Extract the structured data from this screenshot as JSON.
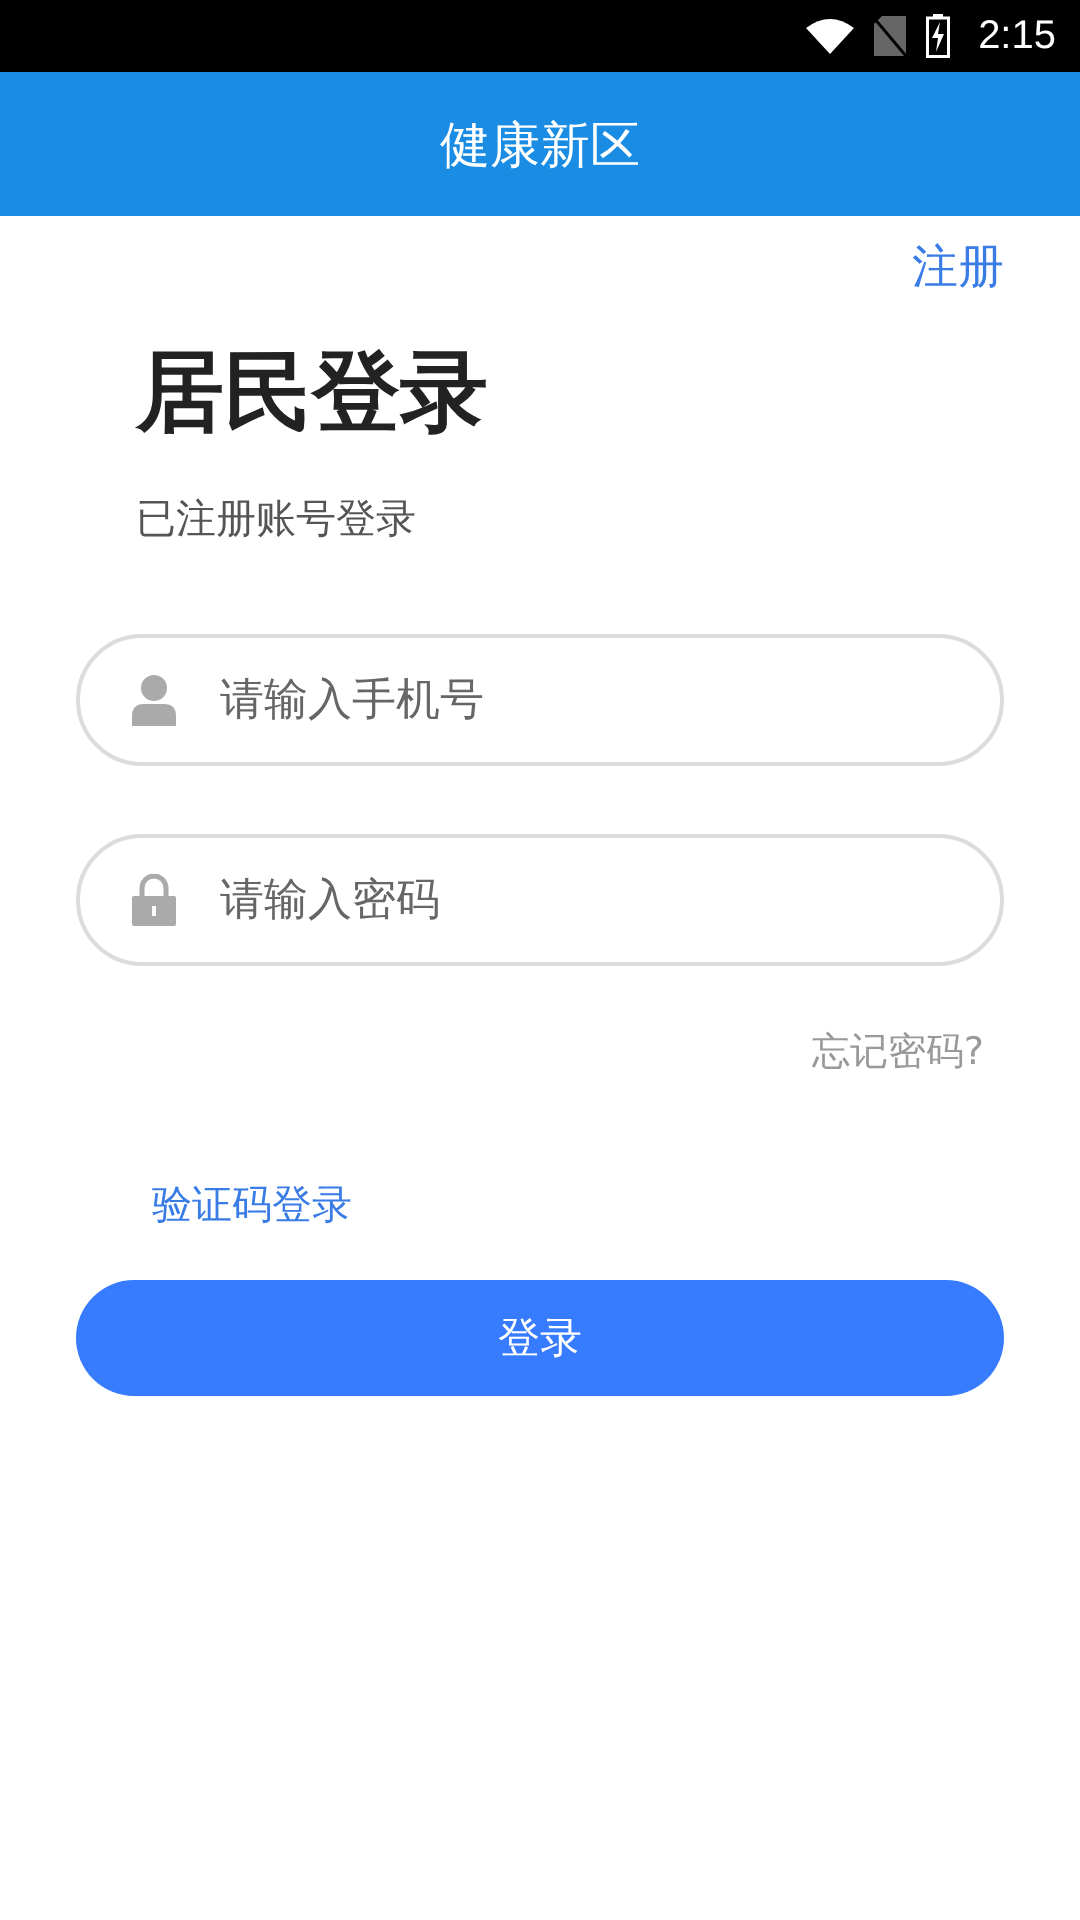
{
  "status_bar": {
    "time": "2:15"
  },
  "header": {
    "title": "健康新区"
  },
  "register_link": "注册",
  "heading": "居民登录",
  "subheading": "已注册账号登录",
  "fields": [
    {
      "kind": "user",
      "placeholder": "请输入手机号"
    },
    {
      "kind": "lock",
      "placeholder": "请输入密码"
    }
  ],
  "forgot_link": "忘记密码?",
  "sms_login_link": "验证码登录",
  "login_button": "登录"
}
